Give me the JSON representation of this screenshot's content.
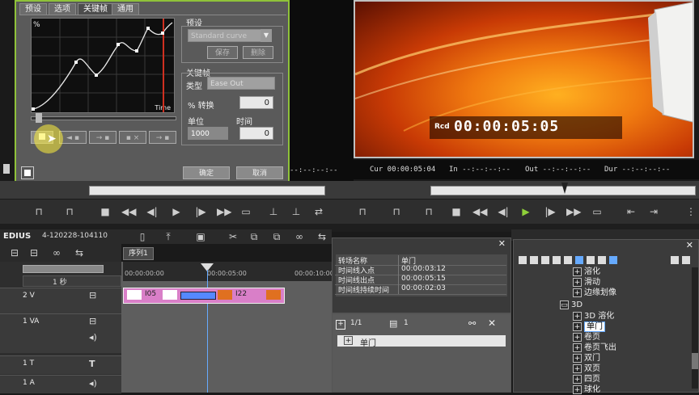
{
  "dialog": {
    "tabs": [
      "预设",
      "选项",
      "关键帧",
      "通用"
    ],
    "graph": {
      "y_label": "%",
      "x_label": "Time"
    },
    "preset_group": {
      "title": "预设",
      "dropdown": "Standard curve",
      "save_btn": "保存",
      "delete_btn": "删除"
    },
    "keyframe_group": {
      "title": "关键帧",
      "type_label": "类型",
      "type_value": "Ease Out",
      "percent_label": "% 转换",
      "percent_value": "0",
      "unit_label": "单位",
      "unit_value": "1000",
      "time_label": "时间",
      "time_value": "0"
    },
    "ok": "确定",
    "cancel": "取消"
  },
  "preview": {
    "rec_label": "Rcd",
    "timecode": "00:00:05:05",
    "cur": "Cur 00:00:05:04",
    "in": "In --:--:--:--",
    "out": "Out --:--:--:--",
    "dur": "Dur --:--:--:--"
  },
  "left_tc": {
    "a": "--:--:--:--",
    "b": "--:--:--:--"
  },
  "timeline": {
    "app_name": "EDIUS",
    "project": "4-120228-104110",
    "sequence_tab": "序列1",
    "scale": "1 秒",
    "ruler": [
      "00:00:00:00",
      "00:00:05:00",
      "00:00:10:00"
    ],
    "tracks": [
      {
        "name": "2 V"
      },
      {
        "name": "1 VA"
      },
      {
        "name": "1 T"
      },
      {
        "name": "1 A"
      }
    ],
    "clips": [
      "I05",
      "I22"
    ]
  },
  "info": {
    "rows": [
      {
        "k": "转场名称",
        "v": "单门"
      },
      {
        "k": "时间线入点",
        "v": "00:00:03:12"
      },
      {
        "k": "时间线出点",
        "v": "00:00:05:15"
      },
      {
        "k": "时间线持续时间",
        "v": "00:00:02:03"
      }
    ]
  },
  "palette": {
    "page": "1/1",
    "count": "1",
    "item": "单门"
  },
  "effects": {
    "items_top": [
      "溶化",
      "滑动",
      "边缘划像"
    ],
    "folder": "3D",
    "items_3d": [
      "3D 溶化",
      "单门",
      "卷页",
      "卷页飞出",
      "双门",
      "双页",
      "四页",
      "球化"
    ]
  }
}
